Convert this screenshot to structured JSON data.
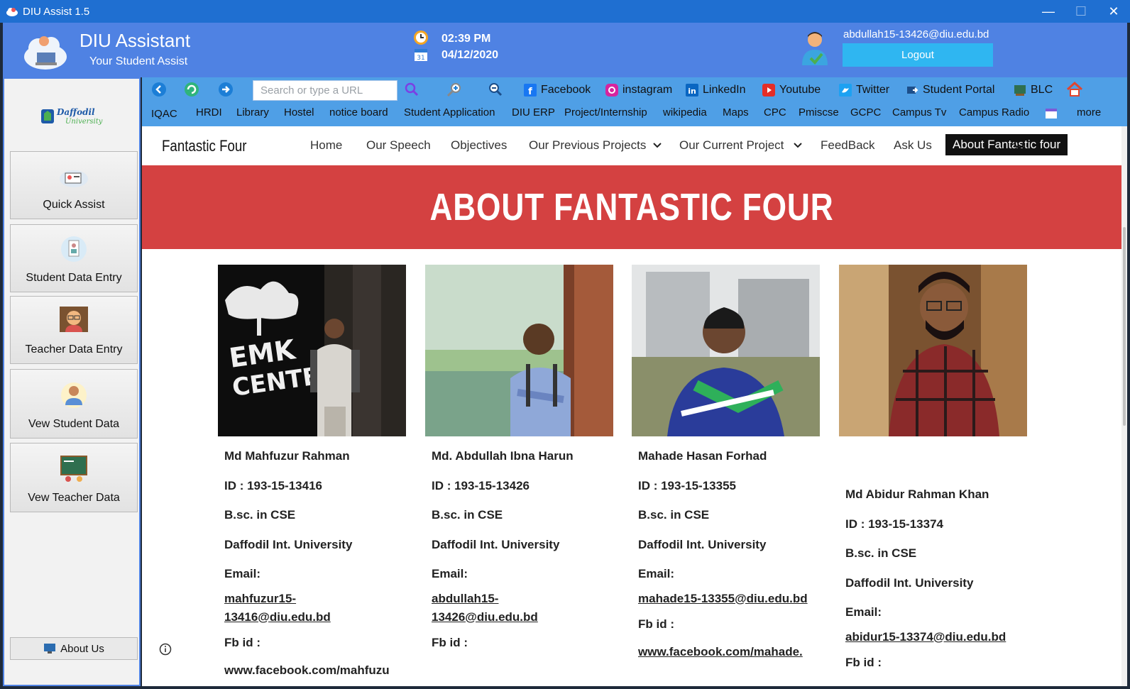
{
  "window": {
    "title": "DIU Assist 1.5"
  },
  "header": {
    "app_name": "DIU Assistant",
    "tagline": "Your Student Assist",
    "time": "02:39 PM",
    "date": "04/12/2020",
    "user_email": "abdullah15-13426@diu.edu.bd",
    "logout_label": "Logout"
  },
  "sidebar": {
    "items": [
      {
        "label": "Quick Assist",
        "icon": "computer-cloud-icon"
      },
      {
        "label": "Student Data Entry",
        "icon": "student-badge-icon"
      },
      {
        "label": "Teacher Data Entry",
        "icon": "teacher-icon"
      },
      {
        "label": "Vew Student Data",
        "icon": "student-view-icon"
      },
      {
        "label": "Vew Teacher Data",
        "icon": "classroom-board-icon"
      }
    ],
    "about_label": "About Us"
  },
  "browser": {
    "url_placeholder": "Search or type a URL",
    "bookmarks": [
      "Facebook",
      "instagram",
      "LinkedIn",
      "Youtube",
      "Twitter",
      "Student Portal",
      "BLC"
    ],
    "links": [
      "IQAC",
      "HRDI",
      "Library",
      "Hostel",
      "notice board",
      "Student Application",
      "DIU ERP",
      "Project/Internship",
      "wikipedia",
      "Maps",
      "CPC",
      "Pmiscse",
      "GCPC",
      "Campus Tv",
      "Campus Radio",
      "more"
    ]
  },
  "site": {
    "brand": "Fantastic Four",
    "nav": [
      "Home",
      "Our Speech",
      "Objectives",
      "Our Previous Projects",
      "Our Current Project",
      "FeedBack",
      "Ask Us",
      "About Fantastic four"
    ],
    "banner": "ABOUT FANTASTIC FOUR",
    "members": [
      {
        "name": "Md Mahfuzur Rahman",
        "id": "ID : 193-15-13416",
        "degree": "B.sc. in CSE",
        "university": "Daffodil Int. University",
        "email_label": "Email:",
        "email": " mahfuzur15-13416@diu.edu.bd",
        "fb_label": "Fb id :",
        "fb": "www.facebook.com/mahfuzu"
      },
      {
        "name": "Md. Abdullah Ibna Harun",
        "id": "ID : 193-15-13426",
        "degree": "B.sc. in CSE",
        "university": "Daffodil Int. University",
        "email_label": "Email:",
        "email": "abdullah15-13426@diu.edu.bd",
        "fb_label": "Fb id :",
        "fb": ""
      },
      {
        "name": "Mahade Hasan Forhad",
        "id": "ID : 193-15-13355",
        "degree": "B.sc. in CSE",
        "university": "Daffodil Int. University",
        "email_label": "Email:",
        "email": "mahade15-13355@diu.edu.bd",
        "fb_label": "Fb id :",
        "fb": "www.facebook.com/mahade."
      },
      {
        "name": "Md Abidur Rahman Khan",
        "id": "ID : 193-15-13374",
        "degree": "B.sc. in CSE",
        "university": "Daffodil Int. University",
        "email_label": "Email:",
        "email": "abidur15-13374@diu.edu.bd",
        "fb_label": "Fb id :",
        "fb": ""
      }
    ]
  },
  "colors": {
    "header": "#4f82e3",
    "titlebar": "#1f6fd1",
    "toolbar": "#4f9fe6",
    "banner": "#d44141",
    "logout": "#2fb6f1"
  }
}
